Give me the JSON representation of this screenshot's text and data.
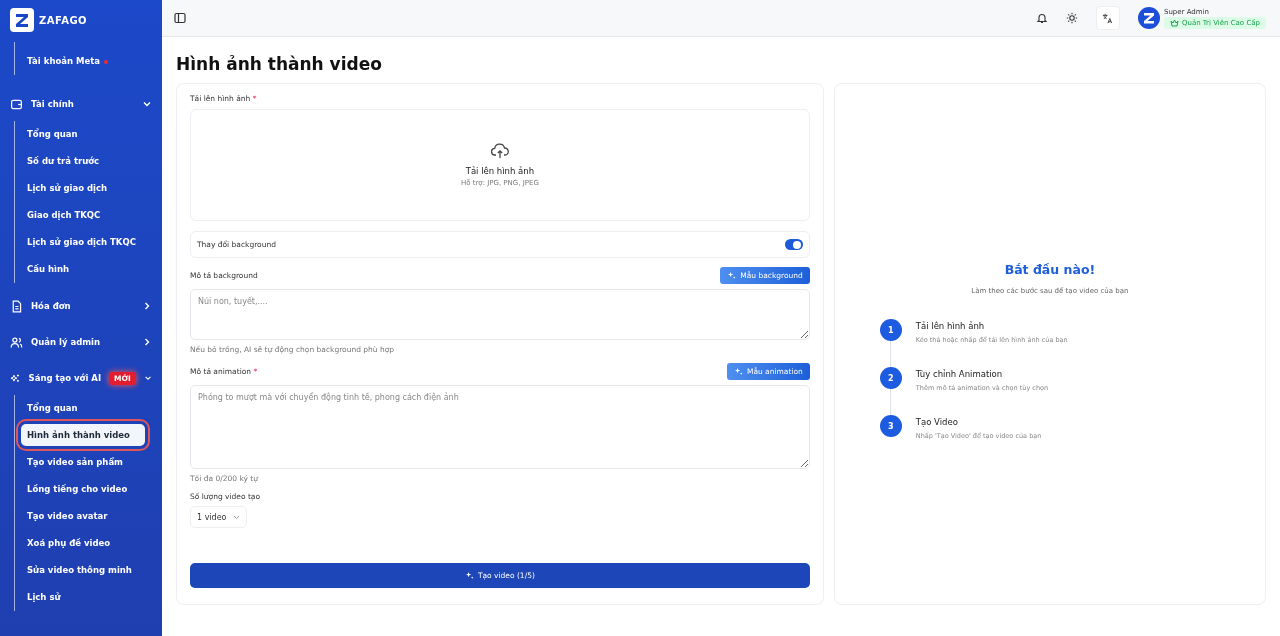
{
  "sidebar": {
    "brand": "ZAFAGO",
    "top_items": [
      {
        "label": "Tài khoản Meta",
        "alert": true
      }
    ],
    "groups": [
      {
        "label": "Tài chính",
        "expanded": true,
        "children": [
          {
            "label": "Tổng quan",
            "selected": false
          },
          {
            "label": "Số dư trả trước",
            "selected": false
          },
          {
            "label": "Lịch sử giao dịch",
            "selected": false
          },
          {
            "label": "Giao dịch TKQC",
            "selected": false
          },
          {
            "label": "Lịch sử giao dịch TKQC",
            "selected": false
          },
          {
            "label": "Cấu hình",
            "selected": false
          }
        ]
      },
      {
        "label": "Hóa đơn",
        "expanded": false
      },
      {
        "label": "Quản lý admin",
        "expanded": false
      },
      {
        "label": "Sáng tạo với AI",
        "expanded": true,
        "badge": "MỚI",
        "children": [
          {
            "label": "Tổng quan",
            "selected": false
          },
          {
            "label": "Hình ảnh thành video",
            "selected": true
          },
          {
            "label": "Tạo video sản phẩm",
            "selected": false
          },
          {
            "label": "Lồng tiếng cho video",
            "selected": false
          },
          {
            "label": "Tạo video avatar",
            "selected": false
          },
          {
            "label": "Xoá phụ đề video",
            "selected": false
          },
          {
            "label": "Sửa video thông minh",
            "selected": false
          },
          {
            "label": "Lịch sử",
            "selected": false
          }
        ]
      }
    ]
  },
  "user": {
    "name": "Super Admin",
    "role": "Quản Trị Viên Cao Cấp"
  },
  "page_title": "Hình ảnh thành video",
  "form": {
    "required_mark": "*",
    "upload_label": "Tải lên hình ảnh",
    "upload_required": true,
    "upload_title": "Tải lên hình ảnh",
    "upload_hint": "Hỗ trợ: JPG, PNG, JPEG",
    "toggle_label": "Thay đổi background",
    "toggle_on": true,
    "bg_label": "Mô tả background",
    "bg_button": "Mẫu background",
    "bg_placeholder": "Núi non, tuyết,....",
    "bg_help": "Nếu bỏ trống, AI sẽ tự động chọn background phù hợp",
    "anim_label": "Mô tả animation",
    "anim_required": true,
    "anim_button": "Mẫu animation",
    "anim_placeholder": "Phóng to mượt mà với chuyển động tinh tế, phong cách điện ảnh",
    "anim_help": "Tối đa 0/200 ký tự",
    "count_label": "Số lượng video tạo",
    "count_value": "1 video",
    "submit": "Tạo video (1/5)"
  },
  "guide": {
    "title": "Bắt đầu nào!",
    "subtitle": "Làm theo các bước sau để tạo video của bạn",
    "steps": [
      {
        "number": "1",
        "title": "Tải lên hình ảnh",
        "text": "Kéo thả hoặc nhấp để tải lên hình ảnh của bạn"
      },
      {
        "number": "2",
        "title": "Tùy chỉnh Animation",
        "text": "Thêm mô tả animation và chọn tùy chọn"
      },
      {
        "number": "3",
        "title": "Tạo Video",
        "text": "Nhấp 'Tạo Video' để tạo video của bạn"
      }
    ]
  }
}
